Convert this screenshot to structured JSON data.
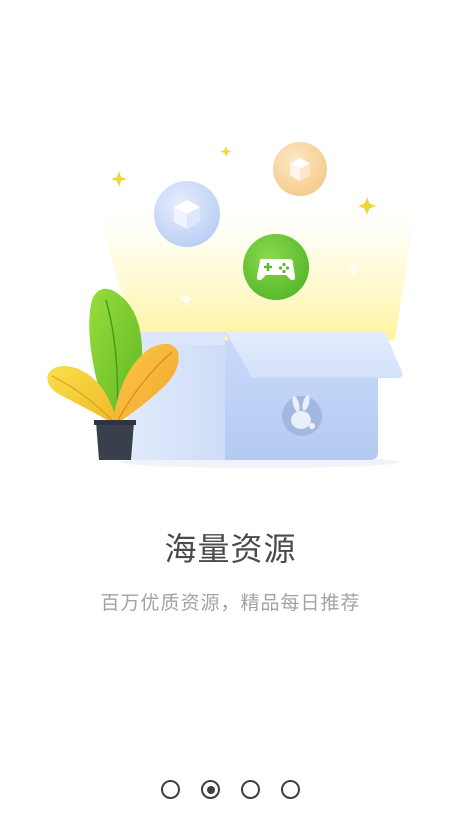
{
  "onboarding": {
    "title": "海量资源",
    "subtitle": "百万优质资源，精品每日推荐",
    "pager": {
      "total_pages": 4,
      "current_page": 2
    }
  },
  "illustration": {
    "icons": [
      "box-icon",
      "box-icon",
      "gamepad-icon",
      "rabbit-logo-icon",
      "plant-icon",
      "sparkle-icon"
    ],
    "colors": {
      "light_beam": "#fff6a8",
      "box_body": "#bcd3f7",
      "gamepad_badge": "#6cc83a",
      "blue_badge": "#c7d8f7",
      "orange_badge": "#f9d7a3",
      "leaf_green": "#7fce2d",
      "leaf_yellow": "#f4cf2c",
      "pot": "#3a3f4c"
    }
  }
}
